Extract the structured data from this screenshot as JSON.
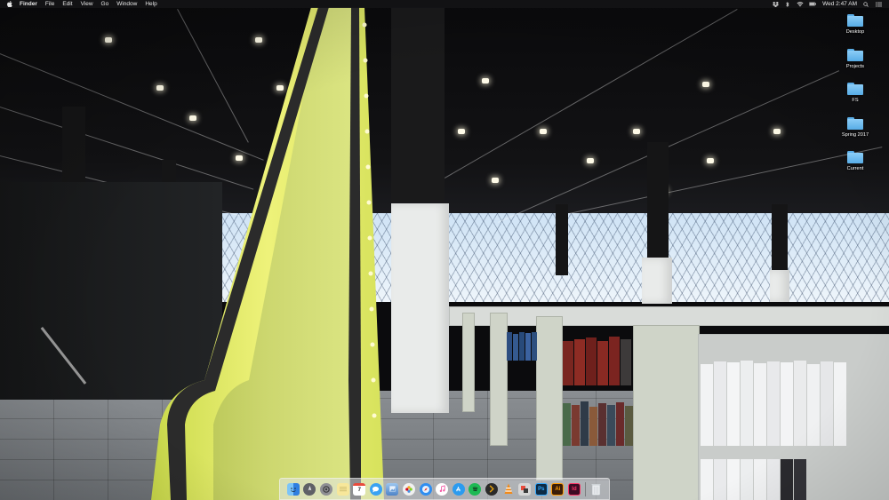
{
  "menubar": {
    "app_name": "Finder",
    "menus": [
      "File",
      "Edit",
      "View",
      "Go",
      "Window",
      "Help"
    ],
    "clock": "Wed 2:47 AM",
    "status_icons": [
      "dropbox-icon",
      "bluetooth-icon",
      "wifi-icon",
      "battery-icon",
      "search-icon",
      "notification-center-icon"
    ]
  },
  "desktop": {
    "icons": [
      {
        "label": "Desktop",
        "type": "folder"
      },
      {
        "label": "Projects",
        "type": "folder"
      },
      {
        "label": "FS",
        "type": "folder"
      },
      {
        "label": "Spring 2017",
        "type": "folder"
      },
      {
        "label": "Current",
        "type": "folder"
      }
    ],
    "folder_color": "#6fbdf2"
  },
  "dock": {
    "apps": [
      {
        "name": "finder-icon",
        "color": "#3d8ff0"
      },
      {
        "name": "launchpad-icon",
        "color": "#6c6c70"
      },
      {
        "name": "system-preferences-icon",
        "color": "#8e8e93"
      },
      {
        "name": "notes-icon",
        "color": "#f7e79a"
      },
      {
        "name": "calendar-icon",
        "color": "#ffffff",
        "text": "7"
      },
      {
        "name": "messages-icon",
        "color": "#3aa2f3"
      },
      {
        "name": "preview-icon",
        "color": "#6b9ed8"
      },
      {
        "name": "photos-icon",
        "color": "#f0f0f0"
      },
      {
        "name": "safari-icon",
        "color": "#2f8ef1"
      },
      {
        "name": "itunes-icon",
        "color": "#f25aa6"
      },
      {
        "name": "app-store-icon",
        "color": "#2b9bef"
      },
      {
        "name": "spotify-icon",
        "color": "#1db954"
      },
      {
        "name": "plex-icon",
        "color": "#2a2a2a"
      },
      {
        "name": "vlc-icon",
        "color": "#f28a18"
      },
      {
        "name": "stickies-app-icon",
        "color": "#d6d6d6"
      },
      {
        "name": "photoshop-icon",
        "color": "#0d2a44",
        "text": "Ps"
      },
      {
        "name": "illustrator-icon",
        "color": "#3b1d08",
        "text": "Ai"
      },
      {
        "name": "indesign-icon",
        "color": "#3d0b24",
        "text": "Id"
      }
    ],
    "trash": {
      "name": "trash-icon"
    }
  }
}
